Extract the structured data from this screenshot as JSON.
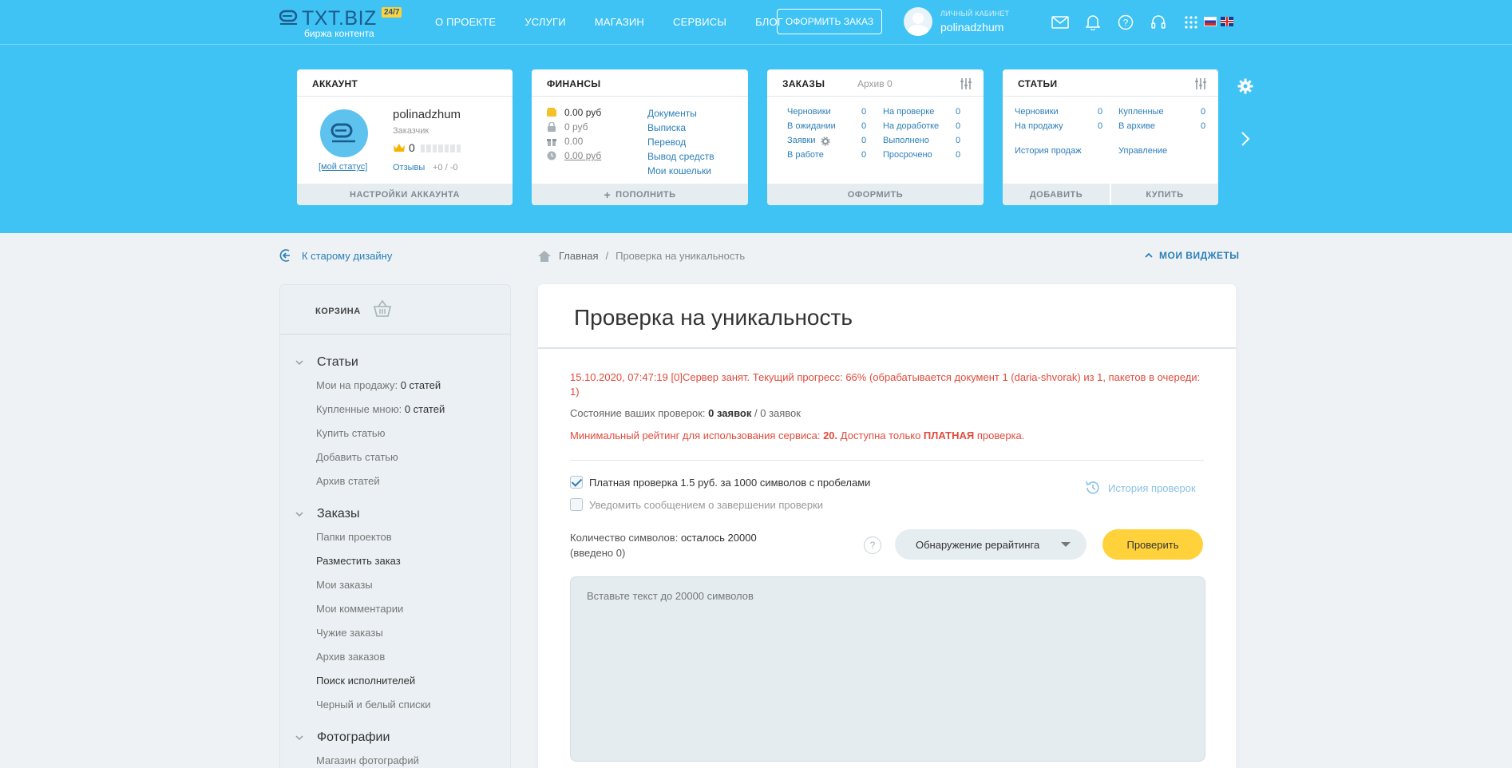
{
  "header": {
    "logo_text": "TXT.BIZ",
    "logo_badge": "24/7",
    "logo_sub": "биржа контента",
    "nav": [
      "О ПРОЕКТЕ",
      "УСЛУГИ",
      "МАГАЗИН",
      "СЕРВИСЫ",
      "БЛОГ"
    ],
    "order_button": "ОФОРМИТЬ ЗАКАЗ",
    "cabinet_label": "ЛИЧНЫЙ КАБИНЕТ",
    "username": "polinadzhum",
    "icons": [
      "mail-icon",
      "bell-icon",
      "help-icon",
      "headset-icon",
      "apps-grid-icon"
    ],
    "languages": [
      "ru",
      "en"
    ]
  },
  "widgets": {
    "account": {
      "title": "АККАУНТ",
      "username": "polinadzhum",
      "role": "Заказчик",
      "rating": "0",
      "status_link": "[мой статус]",
      "reviews_label": "Отзывы",
      "reviews_value": "+0 / -0",
      "footer": "НАСТРОЙКИ АККАУНТА"
    },
    "finance": {
      "title": "ФИНАНСЫ",
      "rows": [
        {
          "value": "0.00 руб",
          "icon": "wallet-icon"
        },
        {
          "value": "0 руб",
          "icon": "lock-icon"
        },
        {
          "value": "0.00",
          "icon": "gift-icon"
        },
        {
          "value": "0.00 руб",
          "icon": "clock-icon"
        }
      ],
      "links": [
        "Документы",
        "Выписка",
        "Перевод",
        "Вывод средств",
        "Мои кошельки"
      ],
      "footer": "ПОПОЛНИТЬ"
    },
    "orders": {
      "title": "ЗАКАЗЫ",
      "archive": "Архив 0",
      "left": [
        {
          "label": "Черновики",
          "value": "0"
        },
        {
          "label": "В ожидании",
          "value": "0"
        },
        {
          "label": "Заявки",
          "value": "0"
        },
        {
          "label": "В работе",
          "value": "0"
        }
      ],
      "right": [
        {
          "label": "На проверке",
          "value": "0"
        },
        {
          "label": "На доработке",
          "value": "0"
        },
        {
          "label": "Выполнено",
          "value": "0"
        },
        {
          "label": "Просрочено",
          "value": "0"
        }
      ],
      "footer": "ОФОРМИТЬ"
    },
    "articles": {
      "title": "СТАТЬИ",
      "left": [
        {
          "label": "Черновики",
          "value": "0"
        },
        {
          "label": "На продажу",
          "value": "0"
        }
      ],
      "right": [
        {
          "label": "Купленные",
          "value": "0"
        },
        {
          "label": "В архиве",
          "value": "0"
        }
      ],
      "sales_history": "История продаж",
      "manage": "Управление",
      "footer_add": "ДОБАВИТЬ",
      "footer_buy": "КУПИТЬ"
    }
  },
  "subheader": {
    "old_design": "К старому дизайну",
    "breadcrumb_home": "Главная",
    "breadcrumb_sep": "/",
    "breadcrumb_current": "Проверка на уникальность",
    "my_widgets": "МОИ ВИДЖЕТЫ"
  },
  "sidebar": {
    "cart": "КОРЗИНА",
    "sections": [
      {
        "title": "Статьи",
        "items": [
          {
            "label": "Мои на продажу:",
            "value": "0 статей"
          },
          {
            "label": "Купленные мною:",
            "value": "0 статей"
          },
          {
            "label": "Купить статью"
          },
          {
            "label": "Добавить статью"
          },
          {
            "label": "Архив статей"
          }
        ]
      },
      {
        "title": "Заказы",
        "items": [
          {
            "label": "Папки проектов"
          },
          {
            "label": "Разместить заказ"
          },
          {
            "label": "Мои заказы"
          },
          {
            "label": "Мои комментарии"
          },
          {
            "label": "Чужие заказы"
          },
          {
            "label": "Архив заказов"
          },
          {
            "label": "Поиск исполнителей"
          },
          {
            "label": "Черный и белый списки"
          }
        ]
      },
      {
        "title": "Фотографии",
        "items": [
          {
            "label": "Магазин фотографий"
          }
        ]
      }
    ]
  },
  "main": {
    "title": "Проверка на уникальность",
    "server_message": "15.10.2020, 07:47:19 [0]Сервер занят. Текущий прогресс: 66% (обрабатывается документ 1 (daria-shvorak) из 1, пакетов в очереди: 1)",
    "state_label": "Состояние ваших проверок:",
    "state_value": "0 заявок",
    "state_total": "/ 0 заявок",
    "min_rating_text": "Минимальный рейтинг для использования сервиса:",
    "min_rating_value": "20.",
    "only_text": "Доступна только",
    "paid_word": "ПЛАТНАЯ",
    "check_word": "проверка.",
    "paid_check_label": "Платная проверка 1.5 руб. за 1000 символов с пробелами",
    "paid_check_checked": true,
    "notify_label": "Уведомить сообщением о завершении проверки",
    "history_link": "История проверок",
    "char_count_label": "Количество символов:",
    "char_count_value": "осталось 20000",
    "char_count_entered": "(введено 0)",
    "mode_select": "Обнаружение рерайтинга",
    "check_button": "Проверить",
    "textarea_placeholder": "Вставьте текст до 20000 символов"
  },
  "colors": {
    "hero": "#3ec3f4",
    "link": "#2c7fb8",
    "error": "#e04b3c",
    "accent_button": "#ffd23c"
  }
}
